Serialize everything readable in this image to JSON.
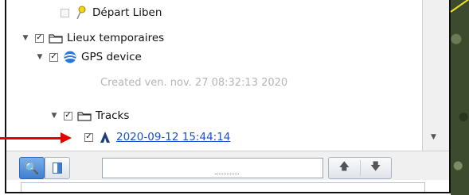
{
  "tree": {
    "items": [
      {
        "label": "Départ Liben",
        "checked": false
      },
      {
        "label": "Lieux temporaires",
        "checked": true
      },
      {
        "label": "GPS device",
        "checked": true
      },
      {
        "label": "Created ven. nov. 27 08:32:13 2020"
      },
      {
        "label": "Tracks",
        "checked": true
      },
      {
        "label": "2020-09-12 15:44:14",
        "checked": true
      }
    ]
  },
  "glyphs": {
    "expanded": "▼",
    "collapsed": "▶",
    "check": "✓",
    "up": "🡅",
    "down": "🡇",
    "search": "🔍"
  },
  "search": {
    "value": "",
    "placeholder": ""
  },
  "colors": {
    "link": "#1a4fd0",
    "annotation_arrow": "#e60000",
    "accent": "#3f7fd0"
  }
}
